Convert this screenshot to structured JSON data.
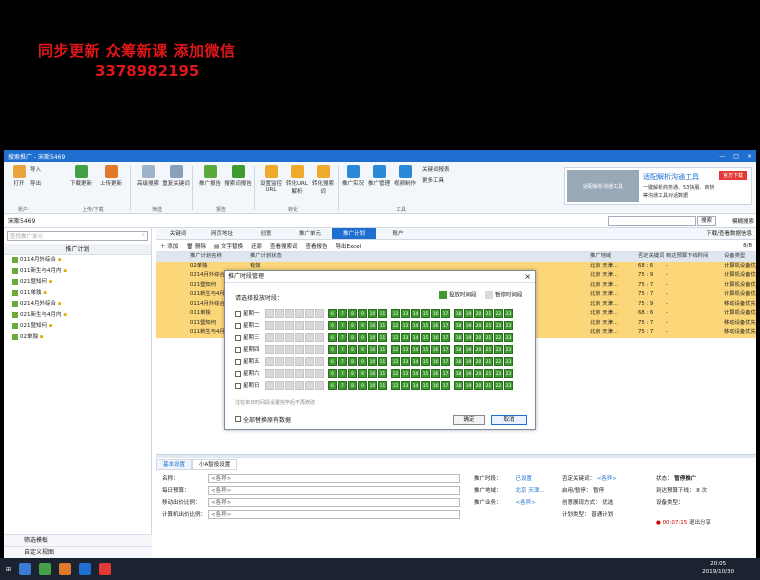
{
  "promo": {
    "line1": "同步更新 众筹新课 添加微信",
    "line2": "3378982195"
  },
  "window": {
    "title": "搜索推广 - 宋斯5469",
    "min": "—",
    "max": "□",
    "close": "×"
  },
  "ribbon": {
    "buttons": [
      {
        "label": "打开",
        "icon": "user-icon"
      },
      {
        "label": "导入",
        "icon": "import-icon"
      },
      {
        "label": "导出",
        "icon": "export-icon"
      },
      {
        "label": "下载更新",
        "icon": "download-icon"
      },
      {
        "label": "上传更新",
        "icon": "upload-icon"
      },
      {
        "label": "高级搜索",
        "icon": "search-icon"
      },
      {
        "label": "重复关键词",
        "icon": "duplicate-icon"
      },
      {
        "label": "推广报告",
        "icon": "report-icon"
      },
      {
        "label": "搜索词报告",
        "icon": "search-report-icon"
      },
      {
        "label": "设置监控URL",
        "icon": "monitor-icon"
      },
      {
        "label": "转化URL解析",
        "icon": "convert-icon"
      },
      {
        "label": "转化搜索词",
        "icon": "convert-word-icon"
      },
      {
        "label": "推广实况",
        "icon": "live-icon"
      },
      {
        "label": "推广管理",
        "icon": "manage-icon"
      },
      {
        "label": "视频制作",
        "icon": "video-icon"
      },
      {
        "label": "关键词报表",
        "icon": "table-icon"
      },
      {
        "label": "更多工具",
        "icon": "more-icon"
      }
    ],
    "groups": [
      "账户",
      "上传/下载",
      "筛选",
      "报告",
      "转化",
      "工具"
    ],
    "ad": {
      "img_text": "适配解析沟通工具",
      "title": "适配解析沟通工具",
      "line1": "一键解析商务通、53快服、商桥",
      "line2": "等沟通工具对话数据",
      "btn": "官方下载"
    }
  },
  "account_bar": {
    "account": "宋斯5469",
    "search_btn": "搜索",
    "fuzzy": "模糊搜索"
  },
  "sidebar": {
    "search_placeholder": "查找推广单元",
    "header": "推广计划",
    "items": [
      "0114月外综合",
      "011新生与4月内",
      "021暨知何",
      "011单独",
      "0214月外综合",
      "021新生与4月内",
      "021暨知何",
      "02单独"
    ],
    "bottom": [
      "筛选模板",
      "自定义视图"
    ]
  },
  "tabs": [
    "关键词",
    "网页地址",
    "创意",
    "推广单元",
    "推广计划",
    "账户"
  ],
  "active_tab": "推广计划",
  "download_link": "下载/查看数据信息",
  "toolbar": {
    "add": "添加",
    "delete": "删除",
    "replace": "文字替换",
    "restore": "还原",
    "view_search": "查看搜索词",
    "view_report": "查看报告",
    "export": "导出Excel",
    "page": "8/8"
  },
  "grid": {
    "headers": [
      "推广计划名称",
      "推广计划状态",
      "",
      "出价比例",
      "推广地域",
      "否定关键词",
      "到达预算下线时间",
      "设备类型"
    ],
    "rows": [
      {
        "name": "02单独",
        "status": "有效",
        "region": "北京 天津...",
        "neg": "68 : 6",
        "reach": "-",
        "device": "计算机设备优先"
      },
      {
        "name": "0214月外综合",
        "status": "有效",
        "region": "北京 天津...",
        "neg": "75 : 9",
        "reach": "-",
        "device": "计算机设备优先"
      },
      {
        "name": "021暨知何",
        "status": "有效",
        "region": "北京 天津...",
        "neg": "75 : 7",
        "reach": "-",
        "device": "计算机设备优先"
      },
      {
        "name": "021新生与4月内",
        "status": "有效",
        "region": "北京 天津...",
        "neg": "75 : 7",
        "reach": "-",
        "device": "计算机设备优先"
      },
      {
        "name": "0114月外综合",
        "status": "有效",
        "region": "北京 天津...",
        "neg": "75 : 9",
        "reach": "-",
        "device": "移动设备优先"
      },
      {
        "name": "011单独",
        "status": "有效",
        "region": "北京 天津...",
        "neg": "68 : 6",
        "reach": "-",
        "device": "计算机设备优先"
      },
      {
        "name": "011暨知何",
        "status": "有效",
        "region": "北京 天津...",
        "neg": "75 : 7",
        "reach": "-",
        "device": "移动设备优先"
      },
      {
        "name": "011新生与4月内",
        "status": "有效",
        "region": "北京 天津...",
        "neg": "75 : 7",
        "reach": "-",
        "device": "移动设备优先"
      }
    ]
  },
  "bottom_tabs": [
    "基本设置",
    "小A智投设置"
  ],
  "form": {
    "name_label": "名称：",
    "name_value": "<各异>",
    "budget_label": "每日预算：",
    "budget_value": "<各异>",
    "mobile_label": "移动出价比例：",
    "mobile_value": "<各异>",
    "pc_label": "计算机出价比例：",
    "pc_value": "<各异>",
    "time_label": "推广时段：",
    "time_value": "已设置",
    "region_label": "推广地域：",
    "region_value": "北京 天津...",
    "biz_label": "推广业务：",
    "biz_value": "<各异>",
    "neg_label": "否定关键词：",
    "neg_value": "<各异>",
    "pause_label": "启用/暂停：",
    "pause_value": "暂停",
    "show_label": "创意展现方式：",
    "show_value": "优选",
    "date_label": "计划类型：",
    "date_value": "普通计划",
    "state_label": "状态：",
    "state_value": "暂停推广",
    "reach_label": "到达预算下线：",
    "reach_value": "8 次",
    "device_label": "设备类型："
  },
  "status": {
    "timer": "00:07:15",
    "exit": "退出分享"
  },
  "taskbar": {
    "time": "20:05",
    "date": "2019/10/30"
  },
  "dialog": {
    "title": "推广时段管理",
    "hint": "请选择投放时段：",
    "legend_on": "投放时间段",
    "legend_off": "暂停时间段",
    "days": [
      "星期一",
      "星期二",
      "星期三",
      "星期四",
      "星期五",
      "星期六",
      "星期日"
    ],
    "hours": [
      "0",
      "1",
      "2",
      "3",
      "4",
      "5",
      "6",
      "7",
      "8",
      "9",
      "10",
      "11",
      "12",
      "13",
      "14",
      "15",
      "16",
      "17",
      "18",
      "19",
      "20",
      "21",
      "22",
      "23"
    ],
    "on_from_hour": 6,
    "sub_hint": "注在单日时间段设置完毕后不再修改",
    "all_label": "全部替换原有数据",
    "ok": "确定",
    "cancel": "取消",
    "colors": {
      "on": "#3f9b2f",
      "off": "#d9d9d9"
    }
  }
}
